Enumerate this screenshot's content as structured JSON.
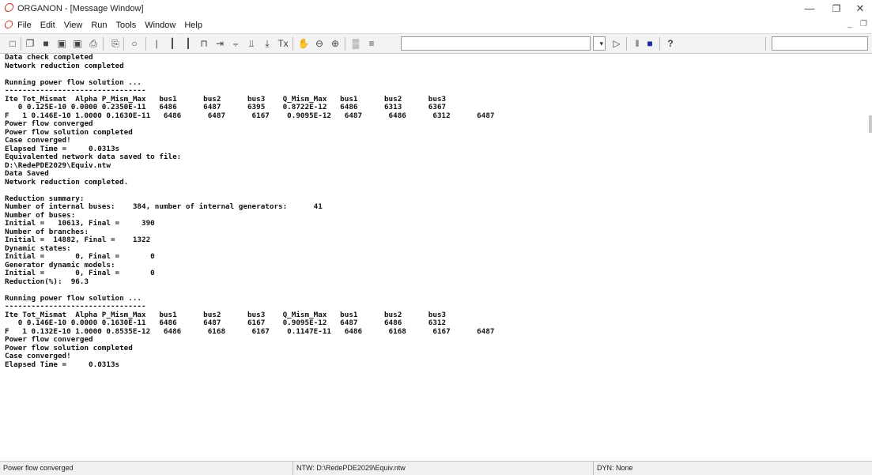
{
  "window": {
    "title": "ORGANON - [Message Window]",
    "controls": {
      "minimize": "—",
      "maximize": "❐",
      "close": "✕"
    },
    "mdi_controls": {
      "minimize": "_",
      "restore": "❐"
    }
  },
  "menu": {
    "items": [
      "File",
      "Edit",
      "View",
      "Run",
      "Tools",
      "Window",
      "Help"
    ]
  },
  "toolbar": {
    "icons": [
      "new-document-icon",
      "open-folder-icon",
      "save-icon",
      "save-all-icon",
      "network-icon",
      "print-icon",
      "copy-icon",
      "zoom-circle-icon",
      "bar-icon",
      "grid-icon",
      "grid2-icon",
      "bracket-icon",
      "arrow-bar-icon",
      "split-icon",
      "step-icon",
      "step-down-icon",
      "tx-icon",
      "hand-icon",
      "zoom-out-icon",
      "zoom-in-icon",
      "chart-icon",
      "export-icon"
    ],
    "glyphs": [
      "□",
      "❐",
      "■",
      "▣",
      "▣",
      "⎙",
      "⎘",
      "○",
      "|",
      "┃",
      "┃",
      "⊓",
      "⇥",
      "⨪",
      "⫫",
      "⤓",
      "Tx",
      "✋",
      "⊖",
      "⊕",
      "▒",
      "≡"
    ],
    "field_value": "",
    "right_glyphs": {
      "dropdown": "▾",
      "play": "▷",
      "pause": "‖",
      "stop": "■",
      "help": "?"
    },
    "right_field_value": ""
  },
  "messages": {
    "lines": [
      "Data check completed",
      "Network reduction completed",
      "",
      "Running power flow solution ...",
      "--------------------------------",
      "Ite Tot_Mismat  Alpha P_Mism_Max   bus1      bus2      bus3    Q_Mism_Max   bus1      bus2      bus3",
      "   0 0.125E-10 0.0000 0.2350E-11   6486      6487      6395    0.8722E-12   6486      6313      6367",
      "F   1 0.146E-10 1.0000 0.1630E-11   6486      6487      6167    0.9095E-12   6487      6486      6312      6487",
      "Power flow converged",
      "Power flow solution completed",
      "Case converged!",
      "Elapsed Time =     0.0313s",
      "Equivalented network data saved to file:",
      "D:\\RedePDE2029\\Equiv.ntw",
      "Data Saved",
      "Network reduction completed.",
      "",
      "Reduction summary:",
      "Number of internal buses:    384, number of internal generators:      41",
      "Number of buses:",
      "Initial =   10613, Final =     390",
      "Number of branches:",
      "Initial =  14882, Final =    1322",
      "Dynamic states:",
      "Initial =       0, Final =       0",
      "Generator dynamic models:",
      "Initial =       0, Final =       0",
      "Reduction(%):  96.3",
      "",
      "Running power flow solution ...",
      "--------------------------------",
      "Ite Tot_Mismat  Alpha P_Mism_Max   bus1      bus2      bus3    Q_Mism_Max   bus1      bus2      bus3",
      "   0 0.146E-10 0.0000 0.1630E-11   6486      6487      6167    0.9095E-12   6487      6486      6312",
      "F   1 0.132E-10 1.0000 0.8535E-12   6486      6168      6167    0.1147E-11   6486      6168      6167      6487",
      "Power flow converged",
      "Power flow solution completed",
      "Case converged!",
      "Elapsed Time =     0.0313s"
    ]
  },
  "status": {
    "message": "Power flow converged",
    "network": "NTW: D:\\RedePDE2029\\Equiv.ntw",
    "dynamics": "DYN: None"
  }
}
